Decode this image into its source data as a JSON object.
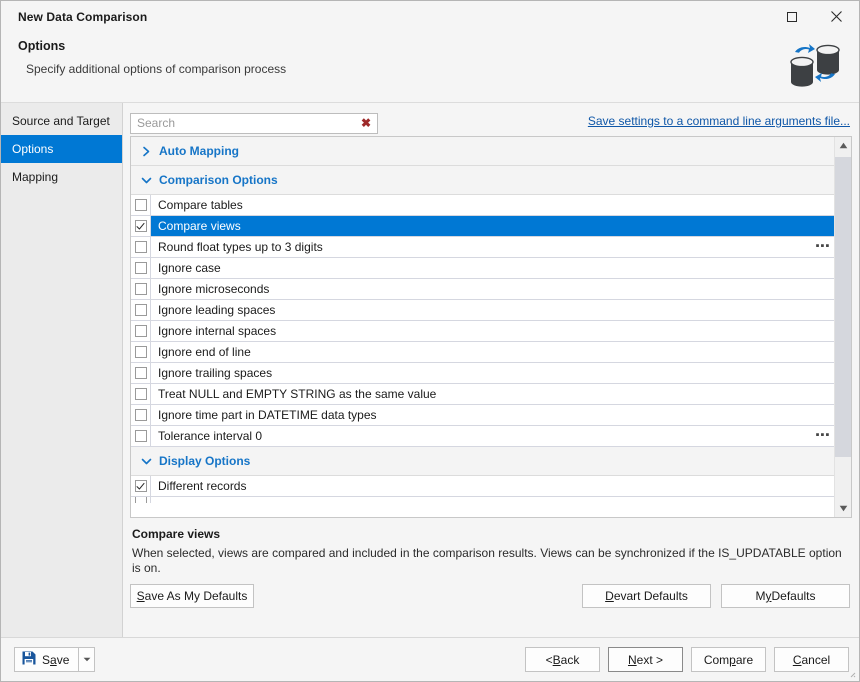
{
  "window": {
    "title": "New Data Comparison",
    "maximize_label": "Maximize",
    "close_label": "Close"
  },
  "header": {
    "title": "Options",
    "subtitle": "Specify additional options of comparison process",
    "logo_name": "data-comparison-logo"
  },
  "sidebar": {
    "items": [
      {
        "label": "Source and Target",
        "active": false
      },
      {
        "label": "Options",
        "active": true
      },
      {
        "label": "Mapping",
        "active": false
      }
    ]
  },
  "search": {
    "value": "",
    "placeholder": "Search",
    "clear_glyph": "✖"
  },
  "links": {
    "command_line": "Save settings to a command line arguments file..."
  },
  "groups": [
    {
      "id": "auto-mapping",
      "label": "Auto Mapping",
      "expanded": false,
      "options": []
    },
    {
      "id": "comparison-options",
      "label": "Comparison Options",
      "expanded": true,
      "options": [
        {
          "label": "Compare tables",
          "checked": false,
          "selected": false,
          "ellipsis": false
        },
        {
          "label": "Compare views",
          "checked": true,
          "selected": true,
          "ellipsis": false
        },
        {
          "label": "Round float types up to 3 digits",
          "checked": false,
          "selected": false,
          "ellipsis": true
        },
        {
          "label": "Ignore case",
          "checked": false,
          "selected": false,
          "ellipsis": false
        },
        {
          "label": "Ignore microseconds",
          "checked": false,
          "selected": false,
          "ellipsis": false
        },
        {
          "label": "Ignore leading spaces",
          "checked": false,
          "selected": false,
          "ellipsis": false
        },
        {
          "label": "Ignore internal spaces",
          "checked": false,
          "selected": false,
          "ellipsis": false
        },
        {
          "label": "Ignore end of line",
          "checked": false,
          "selected": false,
          "ellipsis": false
        },
        {
          "label": "Ignore trailing spaces",
          "checked": false,
          "selected": false,
          "ellipsis": false
        },
        {
          "label": "Treat NULL and EMPTY STRING as the same value",
          "checked": false,
          "selected": false,
          "ellipsis": false
        },
        {
          "label": "Ignore time part in DATETIME data types",
          "checked": false,
          "selected": false,
          "ellipsis": false
        },
        {
          "label": "Tolerance interval 0",
          "checked": false,
          "selected": false,
          "ellipsis": true
        }
      ]
    },
    {
      "id": "display-options",
      "label": "Display Options",
      "expanded": true,
      "options": [
        {
          "label": "Different records",
          "checked": true,
          "selected": false,
          "ellipsis": false
        }
      ]
    }
  ],
  "ellipsis_glyph": "▪▪▪",
  "description": {
    "title": "Compare views",
    "text": "When selected, views are compared and included in the comparison results. Views can be synchronized if the IS_UPDATABLE option is on."
  },
  "defaults_buttons": {
    "save_as_my_defaults": {
      "pre": "",
      "accel": "S",
      "post": "ave As My Defaults"
    },
    "devart_defaults": {
      "pre": "",
      "accel": "D",
      "post": "evart Defaults"
    },
    "my_defaults": {
      "pre": "M",
      "accel": "y",
      "post": " Defaults"
    }
  },
  "footer": {
    "save": {
      "pre": "S",
      "accel": "a",
      "post": "ve"
    },
    "save_icon": "floppy-disk-icon",
    "dropdown_icon": "caret-down-icon",
    "back": {
      "pre": "< ",
      "accel": "B",
      "post": "ack"
    },
    "next": {
      "pre": "",
      "accel": "N",
      "post": "ext >"
    },
    "compare": {
      "pre": "Com",
      "accel": "p",
      "post": "are"
    },
    "cancel": {
      "pre": "",
      "accel": "C",
      "post": "ancel"
    }
  },
  "colors": {
    "accent": "#0078d4",
    "link": "#0f57a8",
    "group_header": "#1675c7",
    "clear_x": "#9e2a2a"
  }
}
